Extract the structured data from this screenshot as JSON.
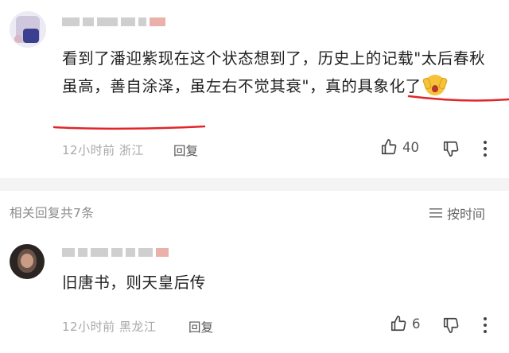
{
  "comments": [
    {
      "text": "看到了潘迎紫现在这个状态想到了，历史上的记载\"太后春秋虽高，善自涂泽，虽左右不觉其衰\"，真的具象化了",
      "time": "12小时前",
      "location": "浙江",
      "reply_label": "回复",
      "likes": "40"
    },
    {
      "text": "旧唐书，则天皇后传",
      "time": "12小时前",
      "location": "黑龙江",
      "reply_label": "回复",
      "likes": "6"
    }
  ],
  "replies_section": {
    "header": "相关回复共7条",
    "sort_label": "按时间"
  },
  "colors": {
    "annotation_red": "#e0252b",
    "meta_gray": "#a9a9a9",
    "separator": "#f4f4f4"
  },
  "icons": [
    "thumbs-up-icon",
    "thumbs-down-icon",
    "more-vertical-icon",
    "sort-lines-icon",
    "emoji-scream"
  ]
}
